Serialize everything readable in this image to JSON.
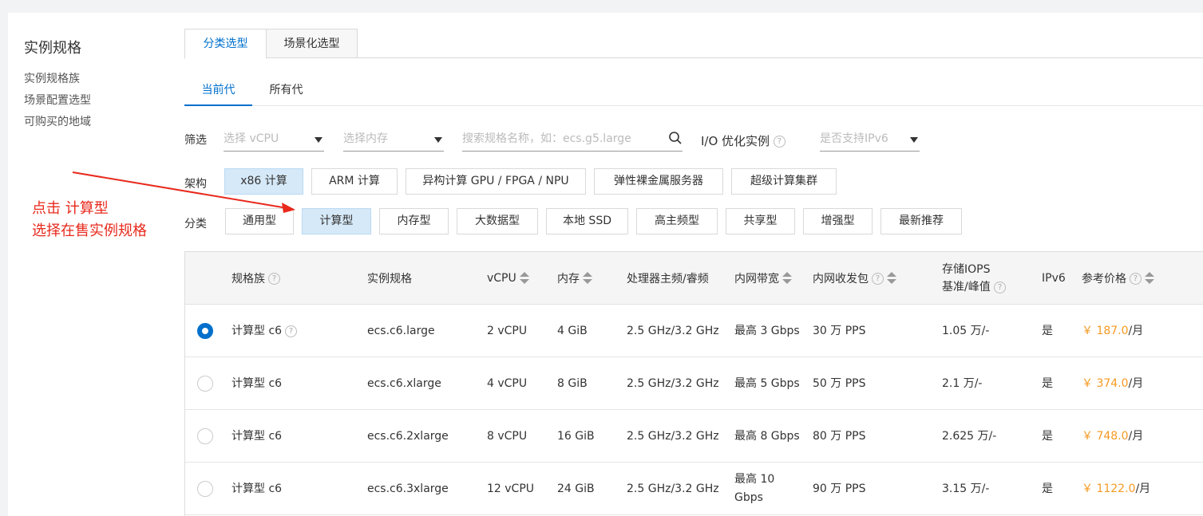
{
  "sidenav": {
    "title": "实例规格",
    "links": [
      "实例规格族",
      "场景配置选型",
      "可购买的地域"
    ]
  },
  "tabs_primary": [
    "分类选型",
    "场景化选型"
  ],
  "tabs_secondary": [
    "当前代",
    "所有代"
  ],
  "filter": {
    "label": "筛选",
    "vcpu_placeholder": "选择 vCPU",
    "memory_placeholder": "选择内存",
    "search_placeholder": "搜索规格名称，如：ecs.g5.large",
    "io_label": "I/O 优化实例",
    "ipv6_placeholder": "是否支持IPv6"
  },
  "arch": {
    "label": "架构",
    "options": [
      "x86 计算",
      "ARM 计算",
      "异构计算 GPU / FPGA / NPU",
      "弹性裸金属服务器",
      "超级计算集群"
    ],
    "selected": "x86 计算"
  },
  "category": {
    "label": "分类",
    "options": [
      "通用型",
      "计算型",
      "内存型",
      "大数据型",
      "本地 SSD",
      "高主频型",
      "共享型",
      "增强型",
      "最新推荐"
    ],
    "selected": "计算型"
  },
  "annotation": {
    "line1": "点击 计算型",
    "line2": "选择在售实例规格",
    "color": "#e8291c"
  },
  "table": {
    "headers": {
      "family": "规格族",
      "spec": "实例规格",
      "vcpu": "vCPU",
      "mem": "内存",
      "freq": "处理器主频/睿频",
      "bandwidth": "内网带宽",
      "pps": "内网收发包",
      "iops_line1": "存储IOPS",
      "iops_line2": "基准/峰值",
      "ipv6": "IPv6",
      "price": "参考价格"
    },
    "rows": [
      {
        "selected": true,
        "family": "计算型 c6",
        "spec": "ecs.c6.large",
        "vcpu": "2 vCPU",
        "mem": "4 GiB",
        "freq": "2.5 GHz/3.2 GHz",
        "bandwidth": "最高 3 Gbps",
        "pps": "30 万 PPS",
        "iops": "1.05 万/-",
        "ipv6": "是",
        "price": "￥ 187.0",
        "unit": " /月"
      },
      {
        "selected": false,
        "family": "计算型 c6",
        "spec": "ecs.c6.xlarge",
        "vcpu": "4 vCPU",
        "mem": "8 GiB",
        "freq": "2.5 GHz/3.2 GHz",
        "bandwidth": "最高 5 Gbps",
        "pps": "50 万 PPS",
        "iops": "2.1 万/-",
        "ipv6": "是",
        "price": "￥ 374.0",
        "unit": " /月"
      },
      {
        "selected": false,
        "family": "计算型 c6",
        "spec": "ecs.c6.2xlarge",
        "vcpu": "8 vCPU",
        "mem": "16 GiB",
        "freq": "2.5 GHz/3.2 GHz",
        "bandwidth": "最高 8 Gbps",
        "pps": "80 万 PPS",
        "iops": "2.625 万/-",
        "ipv6": "是",
        "price": "￥ 748.0",
        "unit": " /月"
      },
      {
        "selected": false,
        "family": "计算型 c6",
        "spec": "ecs.c6.3xlarge",
        "vcpu": "12 vCPU",
        "mem": "24 GiB",
        "freq": "2.5 GHz/3.2 GHz",
        "bandwidth_line1": "最高 10",
        "bandwidth_line2": "Gbps",
        "pps": "90 万 PPS",
        "iops": "3.15 万/-",
        "ipv6": "是",
        "price": "￥ 1122.0",
        "unit": " /月"
      }
    ]
  }
}
